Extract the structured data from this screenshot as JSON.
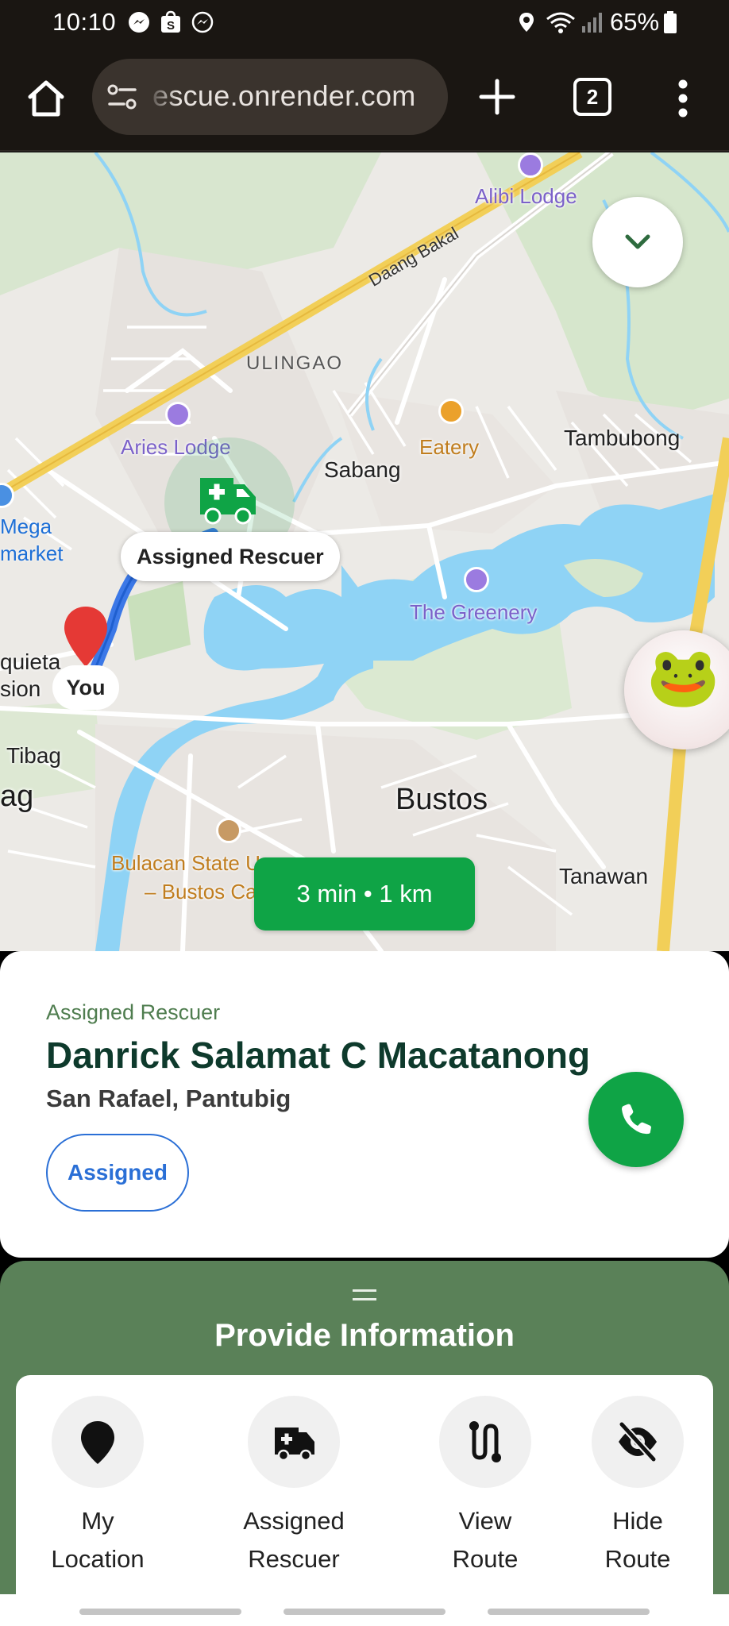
{
  "status_bar": {
    "time": "10:10",
    "battery": "65%",
    "notification_icons": [
      "messenger-icon",
      "shop-icon",
      "messenger-icon"
    ],
    "system_icons": [
      "location-icon",
      "wifi-icon",
      "signal-icon",
      "battery-icon"
    ]
  },
  "browser": {
    "url": "escue.onrender.com",
    "tab_count": "2"
  },
  "map": {
    "labels": {
      "alibi_lodge": "Alibi Lodge",
      "daang_bakal": "Daang Bakal",
      "ulingao": "ULINGAO",
      "aries_lodge": "Aries Lodge",
      "eatery": "Eatery",
      "tambubong": "Tambubong",
      "sabang": "Sabang",
      "mega": "Mega",
      "market": "market",
      "the_greenery": "The Greenery",
      "quieta": "quieta",
      "sion": "sion",
      "tibag": "Tibag",
      "ag": "ag",
      "bustos": "Bustos",
      "bulsu_line1": "Bulacan State U",
      "bulsu_line2": "– Bustos Ca",
      "tanawan": "Tanawan"
    },
    "rescuer_marker_label": "Assigned Rescuer",
    "user_marker_label": "You",
    "eta": "3 min • 1 km",
    "colors": {
      "route": "#3b78e7",
      "water": "#8fd3f5",
      "highway": "#f2cf58",
      "rescuer": "#0fa446",
      "user_pin": "#e53935"
    }
  },
  "rescuer_card": {
    "caption": "Assigned Rescuer",
    "name": "Danrick Salamat C Macatanong",
    "address": "San Rafael, Pantubig",
    "status": "Assigned",
    "accent_color": "#0fa446"
  },
  "sheet": {
    "title": "Provide Information",
    "background_color": "#5a8158",
    "actions": [
      {
        "label": "My\nLocation",
        "icon": "location-pin-icon"
      },
      {
        "label": "Assigned\nRescuer",
        "icon": "ambulance-icon"
      },
      {
        "label": "View\nRoute",
        "icon": "route-icon"
      },
      {
        "label": "Hide\nRoute",
        "icon": "eye-slash-icon"
      }
    ]
  }
}
